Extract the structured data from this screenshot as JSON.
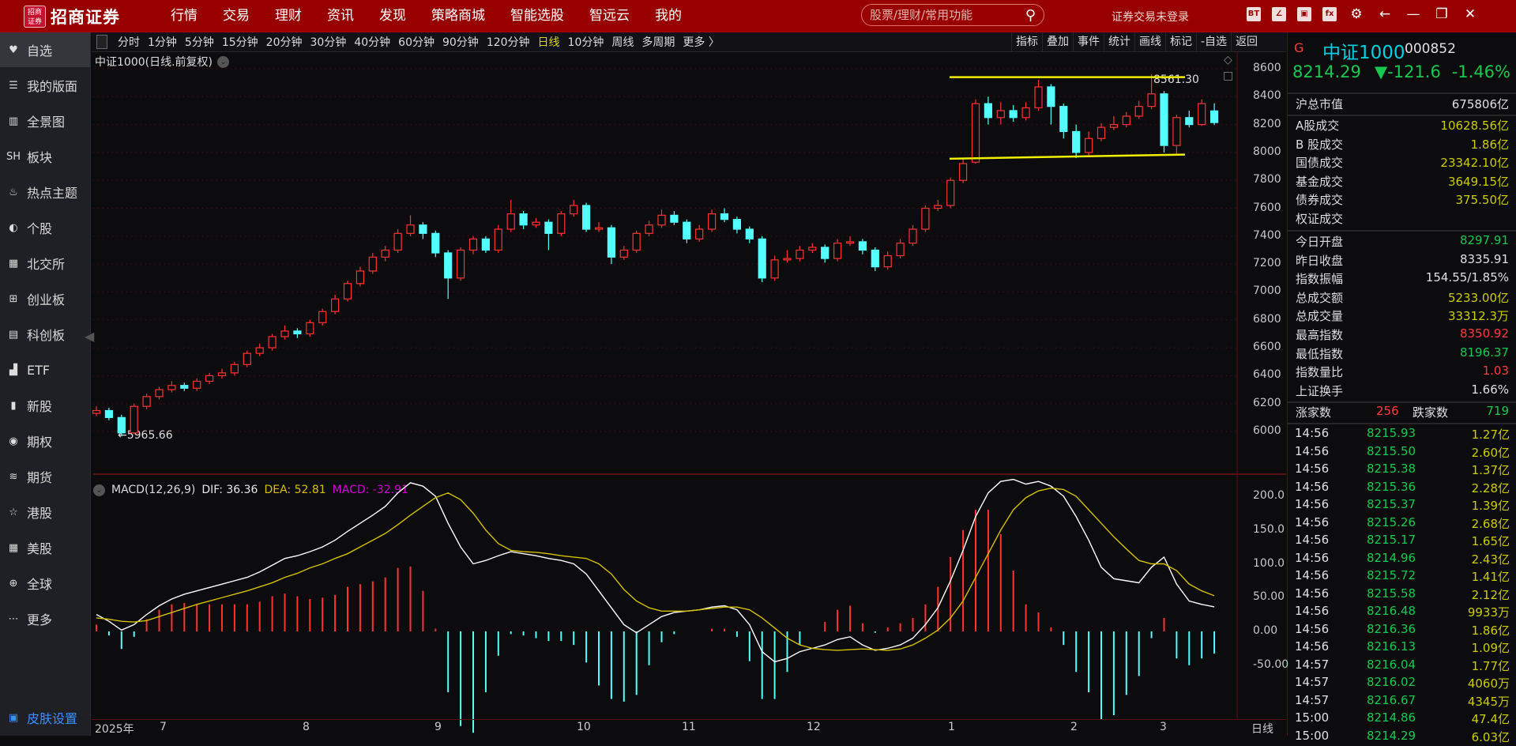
{
  "app": {
    "brand": "招商证券",
    "logo_text": "招商证券"
  },
  "nav": [
    "行情",
    "交易",
    "理财",
    "资讯",
    "发现",
    "策略商城",
    "智能选股",
    "智远云",
    "我的"
  ],
  "search": {
    "placeholder": "股票/理财/常用功能"
  },
  "login_status": "证券交易未登录",
  "top_icons": [
    "trade-box-icon",
    "edit-box-icon",
    "cube-icon",
    "fx-box-icon",
    "gear-icon",
    "back-arrow-icon",
    "minimize-icon",
    "restore-icon",
    "close-icon"
  ],
  "sidebar": [
    {
      "label": "自选",
      "icon": "heart-icon",
      "active": true
    },
    {
      "label": "我的版面",
      "icon": "layout-icon"
    },
    {
      "label": "全景图",
      "icon": "panorama-icon"
    },
    {
      "label": "板块",
      "icon": "sh-icon"
    },
    {
      "label": "热点主题",
      "icon": "fire-icon"
    },
    {
      "label": "个股",
      "icon": "stock-icon"
    },
    {
      "label": "北交所",
      "icon": "bse-icon"
    },
    {
      "label": "创业板",
      "icon": "chinext-icon"
    },
    {
      "label": "科创板",
      "icon": "star-market-icon"
    },
    {
      "label": "ETF",
      "icon": "etf-icon"
    },
    {
      "label": "新股",
      "icon": "ipo-icon"
    },
    {
      "label": "期权",
      "icon": "options-icon"
    },
    {
      "label": "期货",
      "icon": "futures-icon"
    },
    {
      "label": "港股",
      "icon": "hk-icon"
    },
    {
      "label": "美股",
      "icon": "us-icon"
    },
    {
      "label": "全球",
      "icon": "globe-icon"
    },
    {
      "label": "更多",
      "icon": "more-icon"
    }
  ],
  "skin_settings": "皮肤设置",
  "periods": [
    {
      "label": "分时"
    },
    {
      "label": "1分钟"
    },
    {
      "label": "5分钟"
    },
    {
      "label": "15分钟"
    },
    {
      "label": "20分钟"
    },
    {
      "label": "30分钟"
    },
    {
      "label": "40分钟"
    },
    {
      "label": "60分钟"
    },
    {
      "label": "90分钟"
    },
    {
      "label": "120分钟"
    },
    {
      "label": "日线",
      "selected": true
    },
    {
      "label": "10分钟"
    },
    {
      "label": "周线"
    },
    {
      "label": "多周期"
    },
    {
      "label": "更多 〉"
    }
  ],
  "chart_tools": [
    "指标",
    "叠加",
    "事件",
    "统计",
    "画线",
    "标记",
    "-自选",
    "返回"
  ],
  "chart_title": "中证1000(日线.前复权)",
  "macd_header": {
    "name": "MACD(12,26,9)",
    "dif": "DIF: 36.36",
    "dea": "DEA: 52.81",
    "macd": "MACD: -32.91"
  },
  "annotations": {
    "high": "8561.30",
    "low": "←5965.66"
  },
  "period_axis_label": "日线",
  "colors": {
    "up": "#ff3232",
    "down": "#54ffff",
    "dif": "#ffffff",
    "dea": "#d4c000",
    "macd_label": "#d000d0",
    "channel": "#f0f000",
    "grid": "#5a0f0f",
    "topbar": "#980000"
  },
  "chart_data": [
    {
      "type": "candlestick",
      "title": "中证1000(日线.前复权)",
      "ylim": [
        5900,
        8650
      ],
      "yticks": [
        "8600",
        "8400",
        "8200",
        "8000",
        "7800",
        "7600",
        "7400",
        "7200",
        "7000",
        "6800",
        "6600",
        "6400",
        "6200",
        "6000"
      ],
      "x_month_labels": [
        "2025年",
        "7",
        "8",
        "9",
        "10",
        "11",
        "12",
        "1",
        "2",
        "3"
      ],
      "grid": true,
      "channel_lines": [
        [
          8540,
          8540
        ],
        [
          7955,
          7985
        ]
      ],
      "candles": [
        [
          6130,
          6180,
          6110,
          6150
        ],
        [
          6150,
          6170,
          6080,
          6100
        ],
        [
          6100,
          6120,
          5965.66,
          5990
        ],
        [
          5990,
          6200,
          5980,
          6180
        ],
        [
          6180,
          6270,
          6160,
          6250
        ],
        [
          6250,
          6320,
          6230,
          6300
        ],
        [
          6300,
          6360,
          6280,
          6330
        ],
        [
          6330,
          6350,
          6290,
          6310
        ],
        [
          6310,
          6380,
          6290,
          6360
        ],
        [
          6360,
          6420,
          6340,
          6400
        ],
        [
          6400,
          6450,
          6380,
          6420
        ],
        [
          6420,
          6500,
          6400,
          6480
        ],
        [
          6480,
          6580,
          6460,
          6560
        ],
        [
          6560,
          6630,
          6540,
          6600
        ],
        [
          6600,
          6700,
          6580,
          6680
        ],
        [
          6680,
          6760,
          6660,
          6720
        ],
        [
          6720,
          6740,
          6670,
          6700
        ],
        [
          6700,
          6800,
          6680,
          6780
        ],
        [
          6780,
          6880,
          6760,
          6860
        ],
        [
          6860,
          6980,
          6840,
          6950
        ],
        [
          6950,
          7080,
          6930,
          7060
        ],
        [
          7060,
          7180,
          7040,
          7150
        ],
        [
          7150,
          7280,
          7130,
          7250
        ],
        [
          7250,
          7330,
          7220,
          7300
        ],
        [
          7300,
          7450,
          7280,
          7420
        ],
        [
          7420,
          7550,
          7400,
          7480
        ],
        [
          7480,
          7500,
          7380,
          7420
        ],
        [
          7420,
          7440,
          7250,
          7280
        ],
        [
          7280,
          7300,
          6950,
          7100
        ],
        [
          7100,
          7320,
          7080,
          7300
        ],
        [
          7300,
          7400,
          7270,
          7380
        ],
        [
          7380,
          7400,
          7280,
          7300
        ],
        [
          7300,
          7480,
          7280,
          7450
        ],
        [
          7450,
          7660,
          7430,
          7560
        ],
        [
          7560,
          7580,
          7450,
          7480
        ],
        [
          7480,
          7530,
          7460,
          7500
        ],
        [
          7500,
          7520,
          7300,
          7420
        ],
        [
          7420,
          7580,
          7400,
          7560
        ],
        [
          7560,
          7660,
          7540,
          7620
        ],
        [
          7620,
          7640,
          7430,
          7450
        ],
        [
          7450,
          7500,
          7430,
          7460
        ],
        [
          7460,
          7480,
          7200,
          7250
        ],
        [
          7250,
          7330,
          7230,
          7300
        ],
        [
          7300,
          7440,
          7280,
          7420
        ],
        [
          7420,
          7510,
          7400,
          7480
        ],
        [
          7480,
          7590,
          7460,
          7550
        ],
        [
          7550,
          7580,
          7480,
          7500
        ],
        [
          7500,
          7520,
          7350,
          7380
        ],
        [
          7380,
          7480,
          7360,
          7450
        ],
        [
          7450,
          7590,
          7430,
          7560
        ],
        [
          7560,
          7600,
          7500,
          7520
        ],
        [
          7520,
          7540,
          7420,
          7450
        ],
        [
          7450,
          7470,
          7350,
          7380
        ],
        [
          7380,
          7400,
          7070,
          7100
        ],
        [
          7100,
          7260,
          7080,
          7230
        ],
        [
          7230,
          7300,
          7210,
          7240
        ],
        [
          7240,
          7330,
          7220,
          7300
        ],
        [
          7300,
          7350,
          7280,
          7320
        ],
        [
          7320,
          7340,
          7210,
          7240
        ],
        [
          7240,
          7380,
          7220,
          7350
        ],
        [
          7350,
          7400,
          7330,
          7360
        ],
        [
          7360,
          7380,
          7270,
          7300
        ],
        [
          7300,
          7320,
          7150,
          7180
        ],
        [
          7180,
          7290,
          7160,
          7260
        ],
        [
          7260,
          7380,
          7240,
          7350
        ],
        [
          7350,
          7480,
          7330,
          7450
        ],
        [
          7450,
          7620,
          7430,
          7600
        ],
        [
          7600,
          7660,
          7580,
          7620
        ],
        [
          7620,
          7820,
          7600,
          7800
        ],
        [
          7800,
          7960,
          7780,
          7920
        ],
        [
          7930,
          8380,
          7920,
          8350
        ],
        [
          8350,
          8400,
          8200,
          8250
        ],
        [
          8250,
          8360,
          8200,
          8300
        ],
        [
          8300,
          8340,
          8220,
          8250
        ],
        [
          8250,
          8360,
          8230,
          8320
        ],
        [
          8320,
          8520,
          8300,
          8470
        ],
        [
          8470,
          8490,
          8200,
          8330
        ],
        [
          8330,
          8350,
          8100,
          8150
        ],
        [
          8150,
          8200,
          7960,
          8000
        ],
        [
          8000,
          8150,
          7980,
          8100
        ],
        [
          8100,
          8210,
          8080,
          8180
        ],
        [
          8180,
          8260,
          8160,
          8200
        ],
        [
          8200,
          8290,
          8180,
          8260
        ],
        [
          8260,
          8370,
          8240,
          8330
        ],
        [
          8330,
          8561.3,
          8310,
          8420
        ],
        [
          8420,
          8440,
          8000,
          8050
        ],
        [
          8050,
          8270,
          7980,
          8250
        ],
        [
          8250,
          8300,
          8180,
          8200
        ],
        [
          8200,
          8380,
          8190,
          8350
        ],
        [
          8297.91,
          8350.92,
          8196.37,
          8214.29
        ]
      ]
    },
    {
      "type": "line+bar",
      "title": "MACD(12,26,9)",
      "ylim": [
        -110,
        240
      ],
      "yticks": [
        "200.0",
        "150.0",
        "100.0",
        "50.00",
        "0.00",
        "-50.00"
      ],
      "series": [
        {
          "name": "DIF",
          "values": [
            25,
            15,
            2,
            10,
            25,
            38,
            48,
            55,
            60,
            65,
            70,
            75,
            80,
            88,
            98,
            108,
            112,
            118,
            125,
            135,
            148,
            160,
            172,
            185,
            205,
            220,
            215,
            200,
            160,
            125,
            100,
            105,
            112,
            118,
            115,
            112,
            108,
            105,
            100,
            85,
            60,
            35,
            10,
            -2,
            10,
            22,
            28,
            30,
            32,
            36,
            38,
            32,
            10,
            -30,
            -45,
            -40,
            -30,
            -25,
            -20,
            -12,
            -8,
            -20,
            -28,
            -25,
            -20,
            -10,
            10,
            35,
            75,
            120,
            170,
            205,
            222,
            225,
            218,
            222,
            215,
            200,
            170,
            135,
            95,
            78,
            75,
            72,
            95,
            110,
            70,
            45,
            40,
            36.36
          ]
        },
        {
          "name": "DEA",
          "values": [
            20,
            18,
            15,
            14,
            16,
            22,
            28,
            34,
            40,
            45,
            50,
            55,
            60,
            66,
            72,
            80,
            86,
            94,
            100,
            108,
            115,
            125,
            135,
            145,
            158,
            172,
            185,
            198,
            205,
            195,
            175,
            150,
            130,
            120,
            118,
            117,
            115,
            112,
            110,
            108,
            100,
            85,
            62,
            45,
            35,
            30,
            30,
            30,
            32,
            34,
            36,
            36,
            32,
            20,
            5,
            -10,
            -20,
            -25,
            -27,
            -28,
            -27,
            -26,
            -27,
            -28,
            -26,
            -20,
            -10,
            2,
            20,
            45,
            80,
            115,
            150,
            180,
            198,
            208,
            212,
            210,
            200,
            180,
            160,
            140,
            122,
            105,
            100,
            100,
            90,
            70,
            60,
            52.81
          ]
        }
      ]
    }
  ],
  "quote": {
    "flag": "G",
    "name": "中证1000",
    "code": "000852",
    "price": "8214.29",
    "change": "▼-121.6",
    "change_pct": "-1.46%"
  },
  "market_stats": [
    {
      "label": "沪总市值",
      "value": "675806亿",
      "color": "w"
    }
  ],
  "turnover_stats": [
    {
      "label": "A股成交",
      "value": "10628.56亿",
      "color": "y"
    },
    {
      "label": "B 股成交",
      "value": "1.86亿",
      "color": "y"
    },
    {
      "label": "国债成交",
      "value": "23342.10亿",
      "color": "y"
    },
    {
      "label": "基金成交",
      "value": "3649.15亿",
      "color": "y"
    },
    {
      "label": "债券成交",
      "value": "375.50亿",
      "color": "y"
    },
    {
      "label": "权证成交",
      "value": "",
      "color": "y"
    }
  ],
  "index_stats": [
    {
      "label": "今日开盘",
      "value": "8297.91",
      "color": "g"
    },
    {
      "label": "昨日收盘",
      "value": "8335.91",
      "color": "w"
    },
    {
      "label": "指数振幅",
      "value": "154.55/1.85%",
      "color": "w"
    },
    {
      "label": "总成交额",
      "value": "5233.00亿",
      "color": "y"
    },
    {
      "label": "总成交量",
      "value": "33312.3万",
      "color": "y"
    },
    {
      "label": "最高指数",
      "value": "8350.92",
      "color": "r"
    },
    {
      "label": "最低指数",
      "value": "8196.37",
      "color": "g"
    },
    {
      "label": "指数量比",
      "value": "1.03",
      "color": "r"
    },
    {
      "label": "上证换手",
      "value": "1.66%",
      "color": "w"
    }
  ],
  "breadth": {
    "up_label": "涨家数",
    "up": "256",
    "down_label": "跌家数",
    "down": "719"
  },
  "ticks": [
    [
      "14:56",
      "8215.93",
      "1.27亿"
    ],
    [
      "14:56",
      "8215.50",
      "2.60亿"
    ],
    [
      "14:56",
      "8215.38",
      "1.37亿"
    ],
    [
      "14:56",
      "8215.36",
      "2.28亿"
    ],
    [
      "14:56",
      "8215.37",
      "1.39亿"
    ],
    [
      "14:56",
      "8215.26",
      "2.68亿"
    ],
    [
      "14:56",
      "8215.17",
      "1.65亿"
    ],
    [
      "14:56",
      "8214.96",
      "2.43亿"
    ],
    [
      "14:56",
      "8215.72",
      "1.41亿"
    ],
    [
      "14:56",
      "8215.58",
      "2.12亿"
    ],
    [
      "14:56",
      "8216.48",
      "9933万"
    ],
    [
      "14:56",
      "8216.36",
      "1.86亿"
    ],
    [
      "14:56",
      "8216.13",
      "1.09亿"
    ],
    [
      "14:57",
      "8216.04",
      "1.77亿"
    ],
    [
      "14:57",
      "8216.02",
      "4060万"
    ],
    [
      "14:57",
      "8216.67",
      "4345万"
    ],
    [
      "15:00",
      "8214.86",
      "47.4亿"
    ],
    [
      "15:00",
      "8214.29",
      "6.03亿"
    ]
  ]
}
